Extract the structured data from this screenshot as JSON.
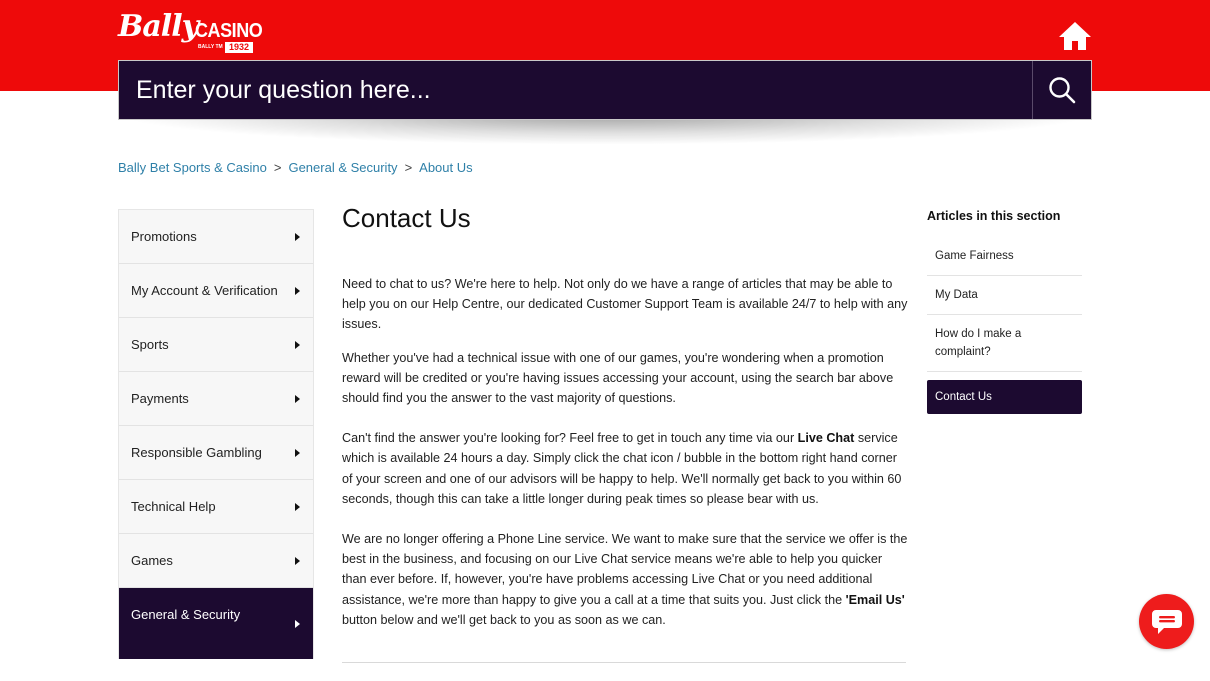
{
  "colors": {
    "brand_red": "#ee0a0a",
    "brand_dark": "#1c0a30",
    "link": "#2f80a8"
  },
  "header": {
    "logo_script": "Bally",
    "logo_word": "CASINO",
    "logo_tm": "BALLY TM",
    "logo_year": "1932",
    "home_icon": "home-icon"
  },
  "search": {
    "placeholder": "Enter your question here...",
    "icon": "search-icon"
  },
  "breadcrumb": {
    "items": [
      "Bally Bet Sports & Casino",
      "General & Security",
      "About Us"
    ],
    "separator": ">"
  },
  "sidebar": {
    "items": [
      {
        "label": "Promotions"
      },
      {
        "label": "My Account & Verification"
      },
      {
        "label": "Sports"
      },
      {
        "label": "Payments"
      },
      {
        "label": "Responsible Gambling"
      },
      {
        "label": "Technical Help"
      },
      {
        "label": "Games"
      },
      {
        "label": "General & Security",
        "active": true
      }
    ]
  },
  "article": {
    "title": "Contact Us",
    "p1": "Need to chat to us? We're here to help. Not only do we have a range of articles that may be able to help you on our Help Centre, our dedicated Customer Support Team is available 24/7 to help with any issues.",
    "p2": "Whether you've had a technical issue with one of our games, you're wondering when a promotion reward will be credited or you're having issues accessing your account, using the search bar above should find you the answer to the vast majority of questions.",
    "p3_a": "Can't find the answer you're looking for? Feel free to get in touch any time via our ",
    "p3_bold": "Live Chat",
    "p3_b": " service which is available 24 hours a day. Simply click the chat icon / bubble in the bottom right hand corner of your screen and one of our advisors will be happy to help. We'll normally get back to you within 60 seconds, though this can take a little longer during peak times so please bear with us.",
    "p4_a": "We are no longer offering a Phone Line service. We want to make sure that the service we offer is the best in the business, and focusing on our Live Chat service means we're able to help you quicker than ever before. If, however, you're have problems accessing Live Chat or you need additional assistance, we're more than happy to give you a call at a time that suits you. Just click the ",
    "p4_bold": "'Email Us'",
    "p4_b": " button below and we'll get back to you as soon as we can."
  },
  "related": {
    "heading": "Articles in this section",
    "items": [
      {
        "label": "Game Fairness"
      },
      {
        "label": "My Data"
      },
      {
        "label": "How do I make a complaint?"
      },
      {
        "label": "Contact Us",
        "active": true
      }
    ]
  },
  "chat": {
    "icon": "chat-bubble-icon"
  }
}
